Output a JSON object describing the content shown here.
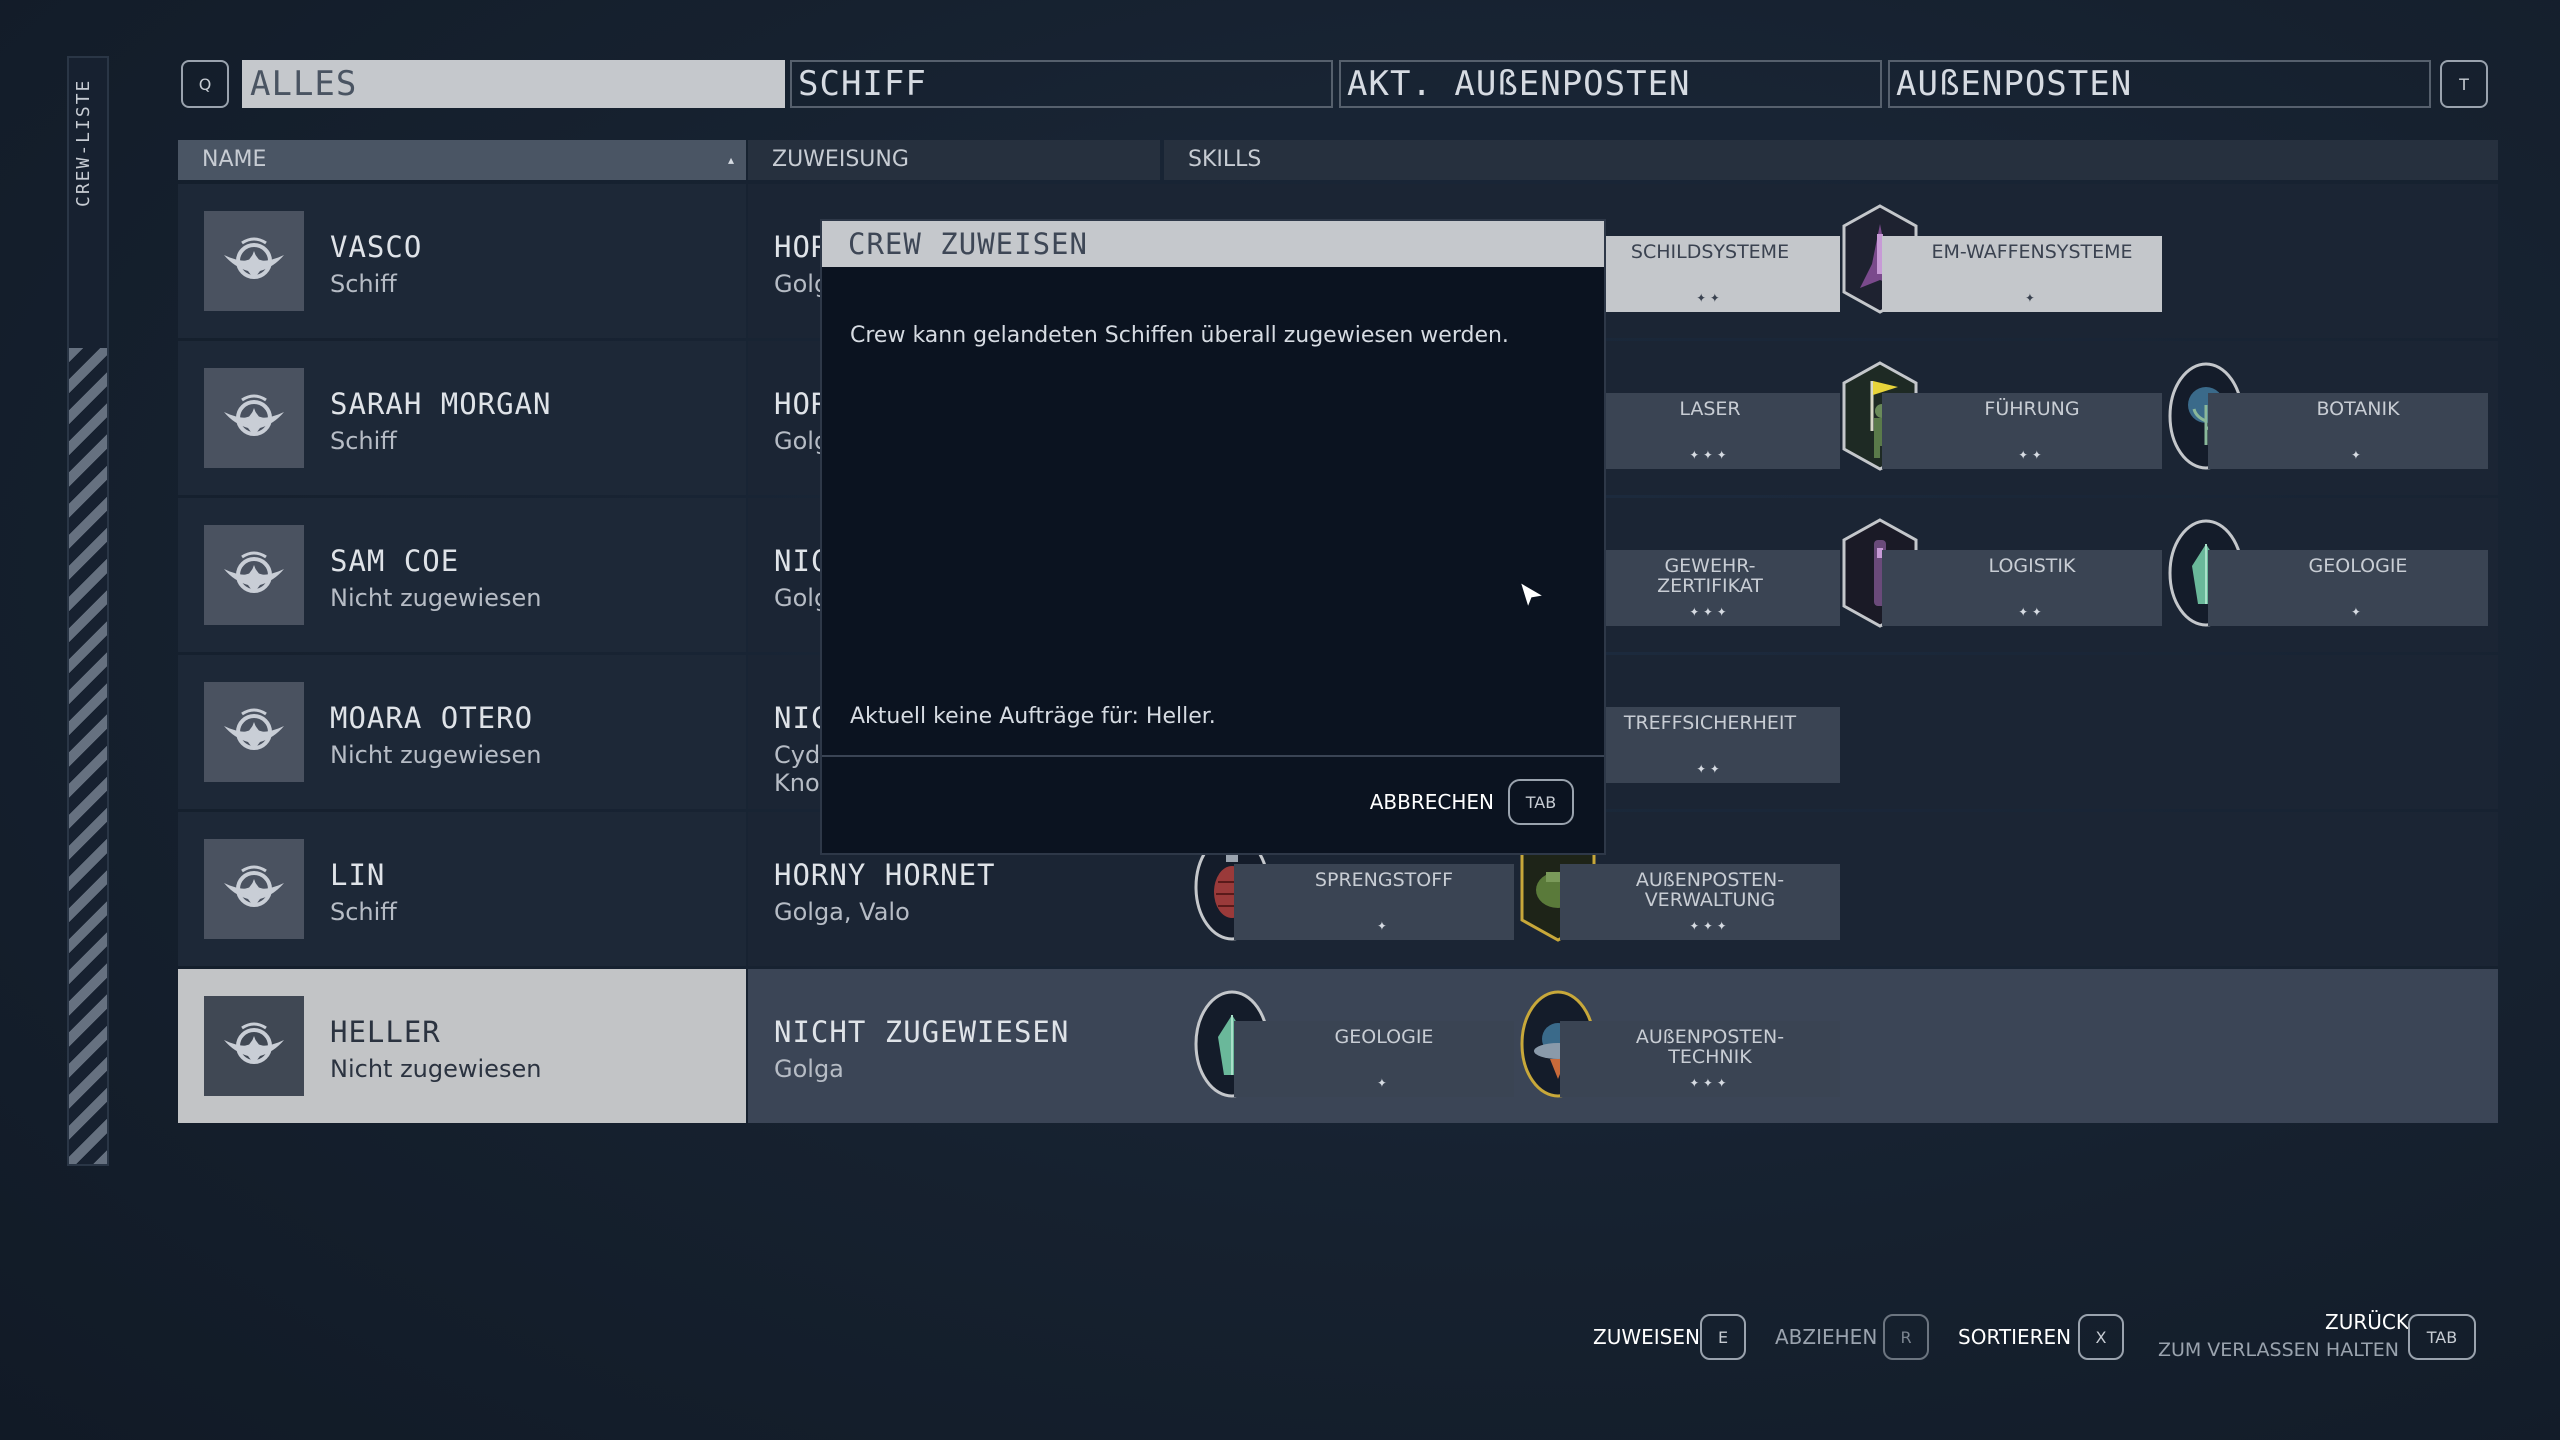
{
  "sidebar": {
    "label": "CREW-LISTE"
  },
  "tabs": {
    "prev_key": "Q",
    "next_key": "T",
    "items": [
      {
        "label": "ALLES",
        "active": true
      },
      {
        "label": "SCHIFF",
        "active": false
      },
      {
        "label": "AKT. AUßENPOSTEN",
        "active": false
      },
      {
        "label": "AUßENPOSTEN",
        "active": false
      }
    ]
  },
  "table": {
    "headers": {
      "name": "NAME",
      "assignment": "ZUWEISUNG",
      "skills": "SKILLS"
    },
    "rows": [
      {
        "name": "VASCO",
        "status": "Schiff",
        "assignment": "HOR",
        "location": "Golg",
        "skills": [
          {
            "name": "SCHILDSYSTEME",
            "rank": "✦✦",
            "icon": "shield-systems-patch-icon"
          },
          {
            "name": "EM-WAFFENSYSTEME",
            "rank": "✦",
            "icon": "em-weapon-systems-patch-icon"
          }
        ]
      },
      {
        "name": "SARAH MORGAN",
        "status": "Schiff",
        "assignment": "HOR",
        "location": "Golg",
        "skills": [
          {
            "name": "LASER",
            "rank": "✦✦✦",
            "icon": "laser-patch-icon"
          },
          {
            "name": "FÜHRUNG",
            "rank": "✦✦",
            "icon": "leadership-patch-icon"
          },
          {
            "name": "BOTANIK",
            "rank": "✦",
            "icon": "botany-patch-icon"
          }
        ]
      },
      {
        "name": "SAM COE",
        "status": "Nicht zugewiesen",
        "assignment": "NIC",
        "location": "Golg",
        "skills": [
          {
            "name": "GEWEHR-\nZERTIFIKAT",
            "rank": "✦✦✦",
            "icon": "rifle-patch-icon"
          },
          {
            "name": "LOGISTIK",
            "rank": "✦✦",
            "icon": "logistics-patch-icon"
          },
          {
            "name": "GEOLOGIE",
            "rank": "✦",
            "icon": "geology-patch-icon"
          }
        ]
      },
      {
        "name": "MOARA OTERO",
        "status": "Nicht zugewiesen",
        "assignment": "NIC",
        "location": "Cyd\nKno",
        "skills": [
          {
            "name": "TREFFSICHERHEIT",
            "rank": "✦✦",
            "icon": "marksmanship-patch-icon"
          }
        ]
      },
      {
        "name": "LIN",
        "status": "Schiff",
        "assignment": "HORNY HORNET",
        "location": "Golga, Valo",
        "skills": [
          {
            "name": "SPRENGSTOFF",
            "rank": "✦",
            "icon": "explosives-grenade-patch-icon"
          },
          {
            "name": "AUßENPOSTEN-\nVERWALTUNG",
            "rank": "✦✦✦",
            "icon": "outpost-management-patch-icon"
          }
        ]
      },
      {
        "name": "HELLER",
        "status": "Nicht zugewiesen",
        "assignment": "NICHT ZUGEWIESEN",
        "location": "Golga",
        "skills": [
          {
            "name": "GEOLOGIE",
            "rank": "✦",
            "icon": "geology-crystal-patch-icon"
          },
          {
            "name": "AUßENPOSTEN-\nTECHNIK",
            "rank": "✦✦✦",
            "icon": "outpost-engineering-patch-icon"
          }
        ]
      }
    ]
  },
  "dialog": {
    "title": "CREW ZUWEISEN",
    "message": "Crew kann gelandeten Schiffen überall zugewiesen werden.",
    "empty_text": "Aktuell keine Aufträge für: Heller.",
    "cancel_label": "ABBRECHEN",
    "cancel_key": "TAB"
  },
  "footer": {
    "assign_label": "ZUWEISEN",
    "assign_key": "E",
    "withdraw_label": "ABZIEHEN",
    "withdraw_key": "R",
    "sort_label": "SORTIEREN",
    "sort_key": "X",
    "back_label": "ZURÜCK",
    "back_sub": "ZUM VERLASSEN HALTEN",
    "back_key": "TAB"
  },
  "colors": {
    "background": "#16212f",
    "selected_row": "#c2c4c6",
    "dialog_bg": "#0b1320",
    "accent_gold": "#c8a83a"
  }
}
